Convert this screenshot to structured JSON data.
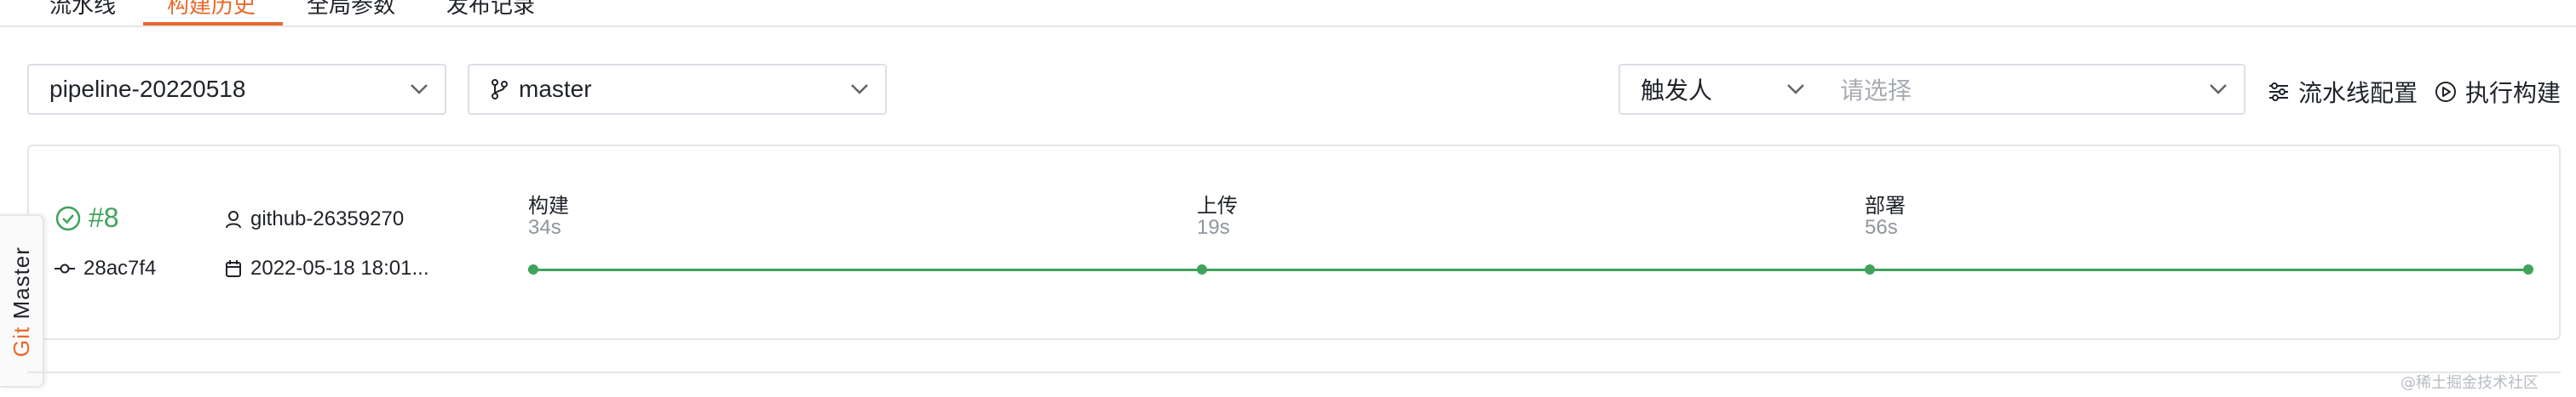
{
  "tabs": [
    {
      "label": "流水线"
    },
    {
      "label": "构建历史"
    },
    {
      "label": "全局参数"
    },
    {
      "label": "发布记录"
    }
  ],
  "filters": {
    "pipeline_value": "pipeline-20220518",
    "branch_value": "master",
    "trigger_label": "触发人",
    "trigger_placeholder": "请选择"
  },
  "actions": {
    "config_label": "流水线配置",
    "run_label": "执行构建"
  },
  "build": {
    "number": "#8",
    "user": "github-26359270",
    "commit": "28ac7f4",
    "time": "2022-05-18 18:01..."
  },
  "stages": [
    {
      "name": "构建",
      "duration": "34s"
    },
    {
      "name": "上传",
      "duration": "19s"
    },
    {
      "name": "部署",
      "duration": "56s"
    }
  ],
  "side_tab": {
    "git": "Git",
    "master": "Master"
  },
  "watermark": "@稀土掘金技术社区",
  "colors": {
    "accent": "#e8692a",
    "success": "#3fa35c",
    "border": "#dcdfe6"
  }
}
